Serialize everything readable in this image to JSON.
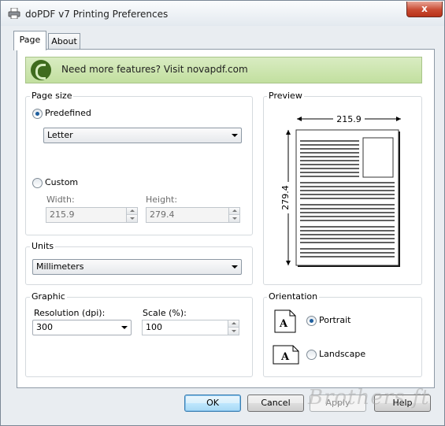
{
  "window": {
    "title": "doPDF v7 Printing Preferences",
    "close_glyph": "x"
  },
  "tabs": [
    {
      "label": "Page",
      "active": true
    },
    {
      "label": "About",
      "active": false
    }
  ],
  "banner": {
    "text": "Need more features? Visit novapdf.com",
    "color": "#c8e3a8"
  },
  "page_size": {
    "label": "Page size",
    "predefined_label": "Predefined",
    "predefined_selected": true,
    "paper_value": "Letter",
    "custom_label": "Custom",
    "width_label": "Width:",
    "width_value": "215.9",
    "height_label": "Height:",
    "height_value": "279.4"
  },
  "units": {
    "label": "Units",
    "value": "Millimeters"
  },
  "graphic": {
    "label": "Graphic",
    "resolution_label": "Resolution (dpi):",
    "resolution_value": "300",
    "scale_label": "Scale (%):",
    "scale_value": "100"
  },
  "preview": {
    "label": "Preview",
    "width_text": "215.9",
    "height_text": "279.4"
  },
  "orientation": {
    "label": "Orientation",
    "portrait_label": "Portrait",
    "landscape_label": "Landscape",
    "portrait_selected": true,
    "icon_letter": "A"
  },
  "buttons": {
    "ok": "OK",
    "cancel": "Cancel",
    "apply": "Apply",
    "help": "Help"
  },
  "watermark": "Brothers.ft",
  "colors": {
    "accent": "#1d5e9e",
    "close": "#c94b32",
    "ok_border": "#3c7fb1"
  }
}
